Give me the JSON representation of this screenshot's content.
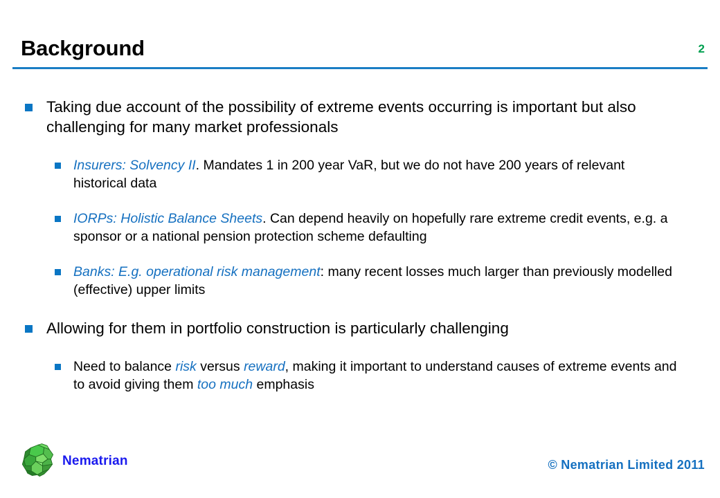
{
  "slide": {
    "title": "Background",
    "page_number": "2",
    "accent_color": "#1a7dc4",
    "page_number_color": "#00a050",
    "highlight_color": "#1570c0",
    "bullet_color": "#0a76c4"
  },
  "content": {
    "bullets": [
      {
        "level": 1,
        "parts": [
          {
            "text": "Taking due account of the possibility of extreme events occurring is important but also challenging for many market professionals",
            "style": "plain"
          }
        ]
      },
      {
        "level": 2,
        "parts": [
          {
            "text": "Insurers: Solvency II",
            "style": "highlight"
          },
          {
            "text": ". Mandates 1 in 200 year VaR, but we do not have 200 years of relevant historical data",
            "style": "plain"
          }
        ]
      },
      {
        "level": 2,
        "parts": [
          {
            "text": "IORPs: Holistic Balance Sheets",
            "style": "highlight"
          },
          {
            "text": ". Can depend heavily on hopefully rare extreme credit events, e.g. a sponsor or a national pension protection scheme defaulting",
            "style": "plain"
          }
        ]
      },
      {
        "level": 2,
        "parts": [
          {
            "text": "Banks: E.g. operational risk management",
            "style": "highlight"
          },
          {
            "text": ": many recent losses much larger than previously modelled (effective) upper limits",
            "style": "plain"
          }
        ]
      },
      {
        "level": 1,
        "parts": [
          {
            "text": "Allowing for them in portfolio construction is particularly challenging",
            "style": "plain"
          }
        ]
      },
      {
        "level": 2,
        "parts": [
          {
            "text": "Need to balance ",
            "style": "plain"
          },
          {
            "text": "risk",
            "style": "highlight"
          },
          {
            "text": " versus ",
            "style": "plain"
          },
          {
            "text": "reward",
            "style": "highlight"
          },
          {
            "text": ", making it important to understand causes of extreme events and to avoid giving them ",
            "style": "plain"
          },
          {
            "text": "too much",
            "style": "highlight"
          },
          {
            "text": " emphasis",
            "style": "plain"
          }
        ]
      }
    ]
  },
  "footer": {
    "logo_icon": "polyhedron-logo-icon",
    "logo_text": "Nematrian",
    "logo_text_color": "#1a1aee",
    "copyright": "© Nematrian Limited 2011"
  }
}
